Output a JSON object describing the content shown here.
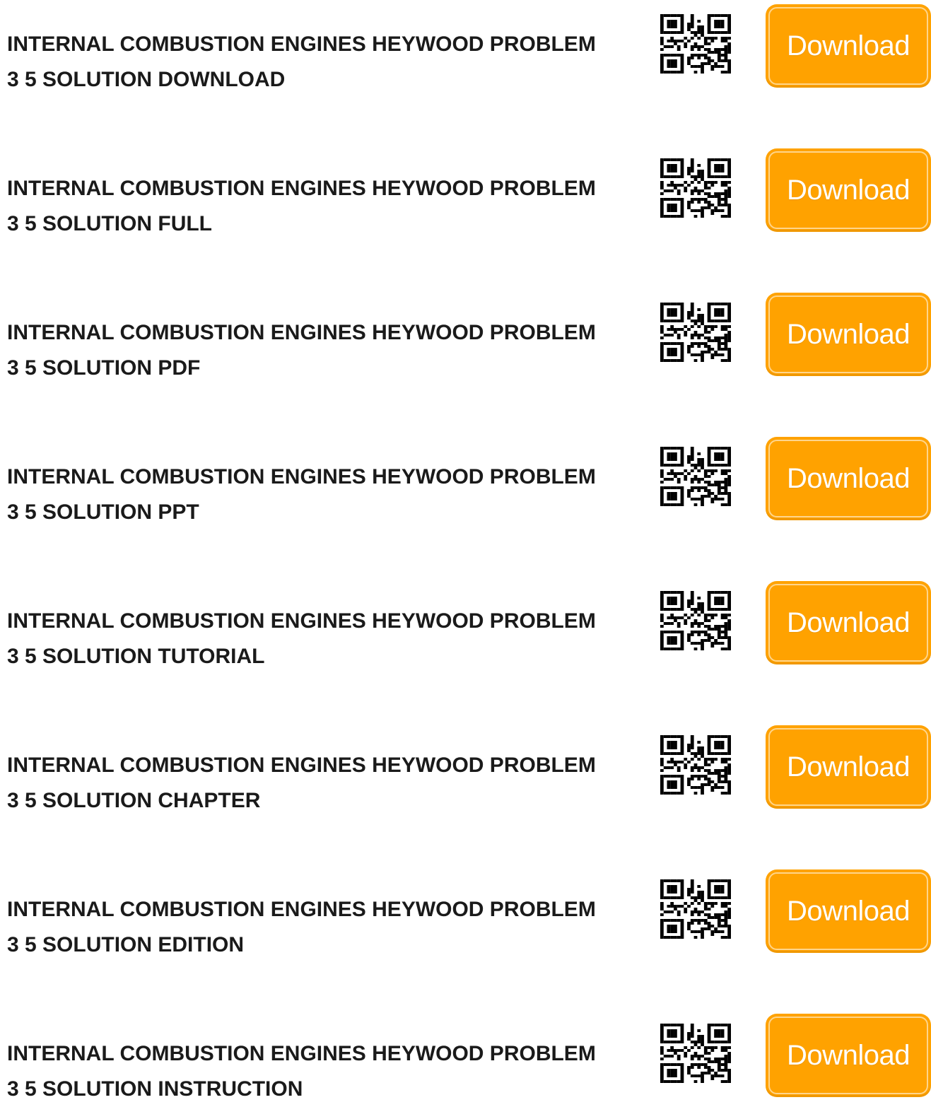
{
  "accent_color": "#ffa200",
  "rows": [
    {
      "title_line1": "INTERNAL COMBUSTION ENGINES HEYWOOD PROBLEM",
      "title_line2": "3 5 SOLUTION DOWNLOAD",
      "qr_icon": "qr-code-icon",
      "button_label": "Download"
    },
    {
      "title_line1": "INTERNAL COMBUSTION ENGINES HEYWOOD PROBLEM",
      "title_line2": "3 5 SOLUTION FULL",
      "qr_icon": "qr-code-icon",
      "button_label": "Download"
    },
    {
      "title_line1": "INTERNAL COMBUSTION ENGINES HEYWOOD PROBLEM",
      "title_line2": "3 5 SOLUTION PDF",
      "qr_icon": "qr-code-icon",
      "button_label": "Download"
    },
    {
      "title_line1": "INTERNAL COMBUSTION ENGINES HEYWOOD PROBLEM",
      "title_line2": "3 5 SOLUTION PPT",
      "qr_icon": "qr-code-icon",
      "button_label": "Download"
    },
    {
      "title_line1": "INTERNAL COMBUSTION ENGINES HEYWOOD PROBLEM",
      "title_line2": "3 5 SOLUTION TUTORIAL",
      "qr_icon": "qr-code-icon",
      "button_label": "Download"
    },
    {
      "title_line1": "INTERNAL COMBUSTION ENGINES HEYWOOD PROBLEM",
      "title_line2": "3 5 SOLUTION CHAPTER",
      "qr_icon": "qr-code-icon",
      "button_label": "Download"
    },
    {
      "title_line1": "INTERNAL COMBUSTION ENGINES HEYWOOD PROBLEM",
      "title_line2": "3 5 SOLUTION EDITION",
      "qr_icon": "qr-code-icon",
      "button_label": "Download"
    },
    {
      "title_line1": "INTERNAL COMBUSTION ENGINES HEYWOOD PROBLEM",
      "title_line2": "3 5 SOLUTION INSTRUCTION",
      "qr_icon": "qr-code-icon",
      "button_label": "Download"
    }
  ]
}
